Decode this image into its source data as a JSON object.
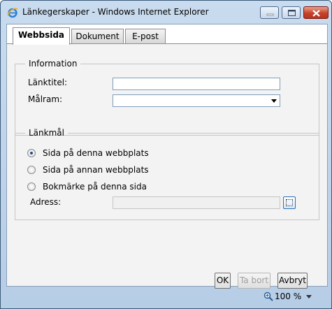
{
  "window": {
    "title": "Länkegerskaper - Windows Internet Explorer"
  },
  "tabs": [
    {
      "label": "Webbsida"
    },
    {
      "label": "Dokument"
    },
    {
      "label": "E-post"
    }
  ],
  "information": {
    "legend": "Information",
    "link_title_label": "Länktitel:",
    "link_title_value": "",
    "target_frame_label": "Målram:",
    "target_frame_value": ""
  },
  "link_target": {
    "legend": "Länkmål",
    "options": [
      {
        "label": "Sida på denna webbplats",
        "checked": true
      },
      {
        "label": "Sida på annan webbplats",
        "checked": false
      },
      {
        "label": "Bokmärke på denna sida",
        "checked": false
      }
    ],
    "address_label": "Adress:",
    "address_value": ""
  },
  "buttons": {
    "ok": "OK",
    "remove": "Ta bort",
    "cancel": "Avbryt"
  },
  "statusbar": {
    "zoom": "100 %"
  },
  "icons": {
    "app": "ie-icon",
    "zoom": "zoom-icon"
  },
  "colors": {
    "accent": "#1a4e8c",
    "close_button": "#c7412b"
  }
}
